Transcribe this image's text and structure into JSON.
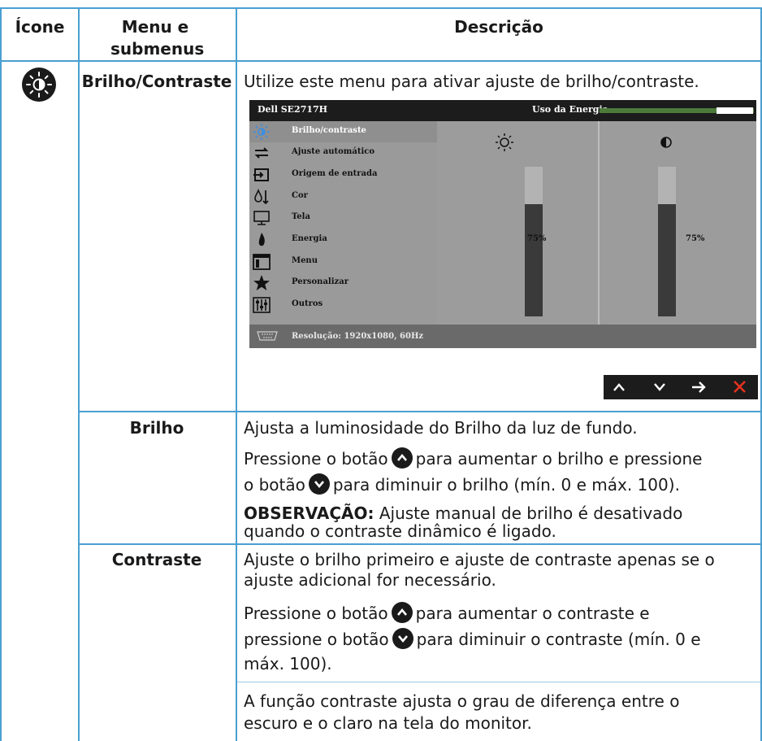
{
  "headers": {
    "icon": "Ícone",
    "menu": "Menu e submenus",
    "desc": "Descrição"
  },
  "row_brilho_contraste": {
    "icon": "brightness-contrast-icon",
    "menu": "Brilho/Contraste",
    "desc": "Utilize este menu para ativar ajuste de brilho/contraste."
  },
  "osd": {
    "model": "Dell SE2717H",
    "energy_label": "Uso da Energia",
    "energy_level": 0.75,
    "items": [
      {
        "label": "Brilho/contraste",
        "icon": "brightness-icon",
        "selected": true
      },
      {
        "label": "Ajuste automático",
        "icon": "auto-adjust-icon"
      },
      {
        "label": "Origem de entrada",
        "icon": "input-source-icon"
      },
      {
        "label": "Cor",
        "icon": "color-icon"
      },
      {
        "label": "Tela",
        "icon": "display-icon"
      },
      {
        "label": "Energia",
        "icon": "energy-icon"
      },
      {
        "label": "Menu",
        "icon": "menu-icon"
      },
      {
        "label": "Personalizar",
        "icon": "personalize-icon"
      },
      {
        "label": "Outros",
        "icon": "others-icon"
      }
    ],
    "brightness_value": "75%",
    "brightness_level": 0.75,
    "contrast_value": "75%",
    "contrast_level": 0.75,
    "resolution": "Resolução: 1920x1080, 60Hz",
    "accent_color": "#4a9fd2",
    "nav_buttons": [
      "up-arrow-icon",
      "down-arrow-icon",
      "right-arrow-icon",
      "close-icon"
    ]
  },
  "row_brilho": {
    "menu": "Brilho",
    "p1": "Ajusta a luminosidade do Brilho da luz de fundo.",
    "p2a": "Pressione o botão",
    "p2b": "para aumentar o brilho e pressione",
    "p2c": "o botão",
    "p2d": "para diminuir o brilho (mín. 0 e máx. 100).",
    "note_label": "OBSERVAÇÃO:",
    "note_a": "Ajuste manual de brilho é desativado",
    "note_b": "quando o contraste dinâmico é ligado."
  },
  "row_contraste": {
    "menu": "Contraste",
    "p1a": "Ajuste o brilho primeiro e ajuste de contraste apenas se o",
    "p1b": "ajuste adicional for necessário.",
    "p2a": "Pressione o botão",
    "p2b": "para aumentar o contraste e",
    "p2c": "pressione o botão",
    "p2d": "para diminuir o contraste (mín. 0 e",
    "p2e": "máx. 100).",
    "p3a": "A função contraste ajusta o grau de diferença entre o",
    "p3b": "escuro e o claro na tela do monitor."
  }
}
